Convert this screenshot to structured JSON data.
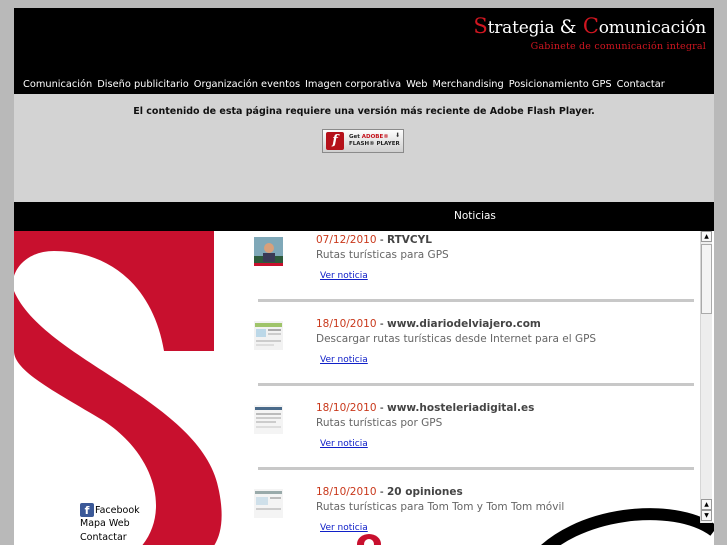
{
  "brand": {
    "title_s_cap": "S",
    "title_s_rest": "trategia ",
    "title_amp": "&",
    "title_c_cap": " C",
    "title_c_rest": "omunicación",
    "subtitle": "Gabinete de comunicación integral",
    "accent_color": "#d01620"
  },
  "nav": {
    "items": [
      "Comunicación",
      "Diseño publicitario",
      "Organización eventos",
      "Imagen corporativa",
      "Web",
      "Merchandising",
      "Posicionamiento GPS",
      "Contactar"
    ]
  },
  "flash": {
    "message": "El contenido de esta página requiere una versión más reciente de Adobe Flash Player.",
    "badge_line1_get": "Get ",
    "badge_line1_adobe": "ADOBE®",
    "badge_line2": "FLASH® PLAYER",
    "logo_letter": "f",
    "download_glyph": "⬇"
  },
  "newsbar": {
    "title": "Noticias"
  },
  "news": [
    {
      "date": "07/12/2010",
      "separator": " - ",
      "source": "RTVCYL",
      "description": "Rutas turísticas para GPS",
      "link": "Ver noticia",
      "thumb": "tv-presenter-thumbnail"
    },
    {
      "date": "18/10/2010",
      "separator": " - ",
      "source": "www.diariodelviajero.com",
      "description": "Descargar rutas turísticas desde Internet para el GPS",
      "link": "Ver noticia",
      "thumb": "website-thumbnail"
    },
    {
      "date": "18/10/2010",
      "separator": " - ",
      "source": "www.hosteleriadigital.es",
      "description": "Rutas turísticas por GPS",
      "link": "Ver noticia",
      "thumb": "website-thumbnail"
    },
    {
      "date": "18/10/2010",
      "separator": " - ",
      "source": "20 opiniones",
      "description": "Rutas turísticas para Tom Tom y Tom Tom móvil",
      "link": "Ver noticia",
      "thumb": "website-thumbnail"
    }
  ],
  "footer": {
    "fb_glyph": "f",
    "facebook": "Facebook",
    "sitemap": "Mapa Web",
    "contact": "Contactar"
  },
  "scrollbar": {
    "up_glyph": "▲",
    "down_glyph": "▼"
  }
}
